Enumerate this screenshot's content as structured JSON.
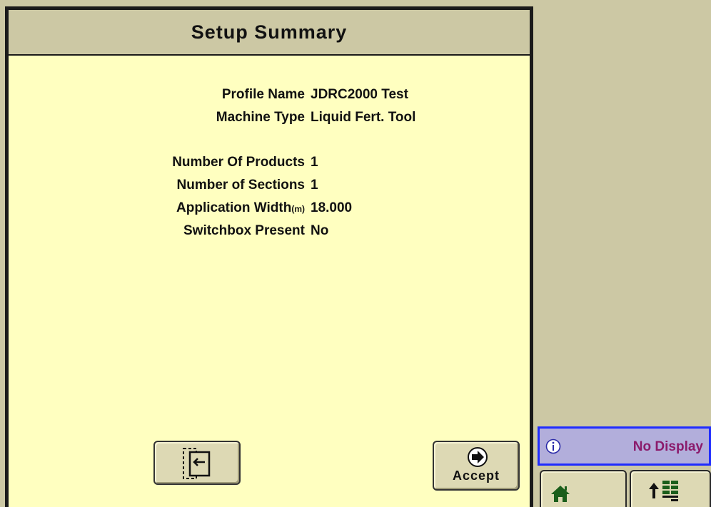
{
  "dialog": {
    "title": "Setup Summary",
    "rows": [
      {
        "label": "Profile Name",
        "value": "JDRC2000 Test"
      },
      {
        "label": "Machine Type",
        "value": "Liquid Fert. Tool"
      },
      {
        "label": "Number Of Products",
        "value": "1"
      },
      {
        "label": "Number of Sections",
        "value": "1"
      },
      {
        "label": "Application Width",
        "unit": "(m)",
        "value": "18.000"
      },
      {
        "label": "Switchbox Present",
        "value": "No"
      }
    ],
    "accept_label": "Accept",
    "back_icon": "exit-back-icon",
    "accept_icon": "accept-arrow-icon"
  },
  "status": {
    "info_icon": "info-icon",
    "message": "No Display"
  },
  "softkeys": {
    "home_icon": "home-icon",
    "layout_icon": "layout-manager-icon"
  },
  "colors": {
    "panel": "#ffffc0",
    "chrome": "#ccc8a4",
    "info_border": "#1f2cff",
    "info_bg": "#b2aedb",
    "info_text": "#8b1a6b",
    "icon_green": "#1b5e1b"
  }
}
